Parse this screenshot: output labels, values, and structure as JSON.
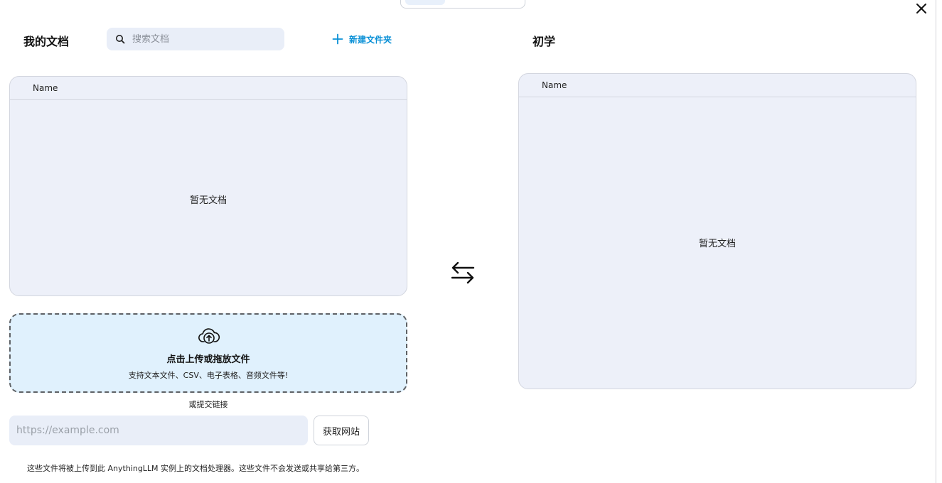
{
  "close_button": {
    "icon": "close-icon"
  },
  "left": {
    "title": "我的文档",
    "search": {
      "placeholder": "搜索文档",
      "value": ""
    },
    "new_folder_label": "新建文件夹",
    "table": {
      "column_header": "Name",
      "empty_text": "暂无文档"
    },
    "upload": {
      "title": "点击上传或拖放文件",
      "subtitle": "支持文本文件、CSV、电子表格、音频文件等!"
    },
    "link": {
      "label": "或提交链接",
      "placeholder": "https://example.com",
      "value": "",
      "fetch_label": "获取网站"
    },
    "footnote": "这些文件将被上传到此 AnythingLLM 实例上的文档处理器。这些文件不会发送或共享给第三方。"
  },
  "right": {
    "title": "初学",
    "table": {
      "column_header": "Name",
      "empty_text": "暂无文档"
    }
  },
  "swap": {
    "icon": "swap-arrows-icon"
  },
  "colors": {
    "accent": "#0a90d6",
    "panel_bg": "#edf0f9",
    "dropzone_bg": "#e0f1fd",
    "input_bg": "#e9eef8"
  }
}
